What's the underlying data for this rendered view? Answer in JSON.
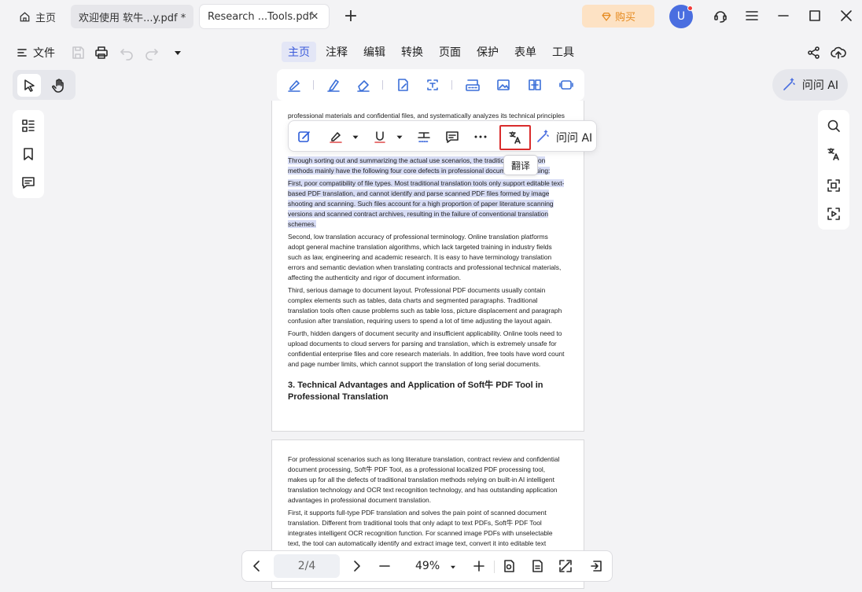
{
  "tabs": {
    "home_label": "主页",
    "tab1_label": "欢迎使用 软牛...y.pdf *",
    "tab2_label": "Research ...Tools.pdf",
    "close_glyph": "✕",
    "new_tab_glyph": "+"
  },
  "titlebar": {
    "buy_label": "购买",
    "avatar_letter": "U"
  },
  "toolbar": {
    "file_label": "文件"
  },
  "menu": {
    "items": [
      "主页",
      "注释",
      "编辑",
      "转换",
      "页面",
      "保护",
      "表单",
      "工具"
    ],
    "active": "主页"
  },
  "ask_ai": {
    "label": "问问 AI"
  },
  "floating_toolbar": {
    "translate_tooltip": "翻译",
    "ask_ai_label": "问问 AI"
  },
  "document": {
    "page1_top_line": "professional materials and confidential files, and systematically analyzes its technical principles",
    "page1_paragraphs": [
      "Through sorting out and summarizing the actual use scenarios, the traditional translation methods mainly have the following four core defects in professional document processing:",
      "First, poor compatibility of file types. Most traditional translation tools only support editable text-based PDF translation, and cannot identify and parse scanned PDF files formed by image shooting and scanning. Such files account for a high proportion of paper literature scanning versions and scanned contract archives, resulting in the failure of conventional translation schemes.",
      "Second, low translation accuracy of professional terminology. Online translation platforms adopt general machine translation algorithms, which lack targeted training in industry fields such as law, engineering and academic research. It is easy to have terminology translation errors and semantic deviation when translating contracts and professional technical materials, affecting the authenticity and rigor of document information.",
      "Third, serious damage to document layout. Professional PDF documents usually contain complex elements such as tables, data charts and segmented paragraphs. Traditional translation tools often cause problems such as table loss, picture displacement and paragraph confusion after translation, requiring users to spend a lot of time adjusting the layout again.",
      "Fourth, hidden dangers of document security and insufficient applicability. Online tools need to upload documents to cloud servers for parsing and translation, which is extremely unsafe for confidential enterprise files and core research materials. In addition, free tools have word count and page number limits, which cannot support the translation of long serial documents."
    ],
    "page1_heading": "3. Technical Advantages and Application of Soft牛 PDF Tool in Professional Translation",
    "page2_paragraphs": [
      "For professional scenarios such as long literature translation, contract review and confidential document processing, Soft牛 PDF Tool, as a professional localized PDF processing tool, makes up for all the defects of traditional translation methods relying on built-in AI intelligent translation technology and OCR text recognition technology, and has outstanding application advantages in professional document translation.",
      "First, it supports full-type PDF translation and solves the pain point of scanned document translation. Different from traditional tools that only adapt to text PDFs, Soft牛 PDF Tool integrates intelligent OCR recognition function. For scanned image PDFs with unselectable text, the tool can automatically identify and extract image text, convert it into editable text content,"
    ]
  },
  "bottom_bar": {
    "page_indicator": "2/4",
    "zoom_value": "49%"
  },
  "colors": {
    "accent": "#3b5bdb",
    "highlight": "#d7dcf5",
    "buy_bg": "#fde2c4",
    "buy_text": "#e58a1f",
    "translate_outline": "#d92c2c"
  }
}
